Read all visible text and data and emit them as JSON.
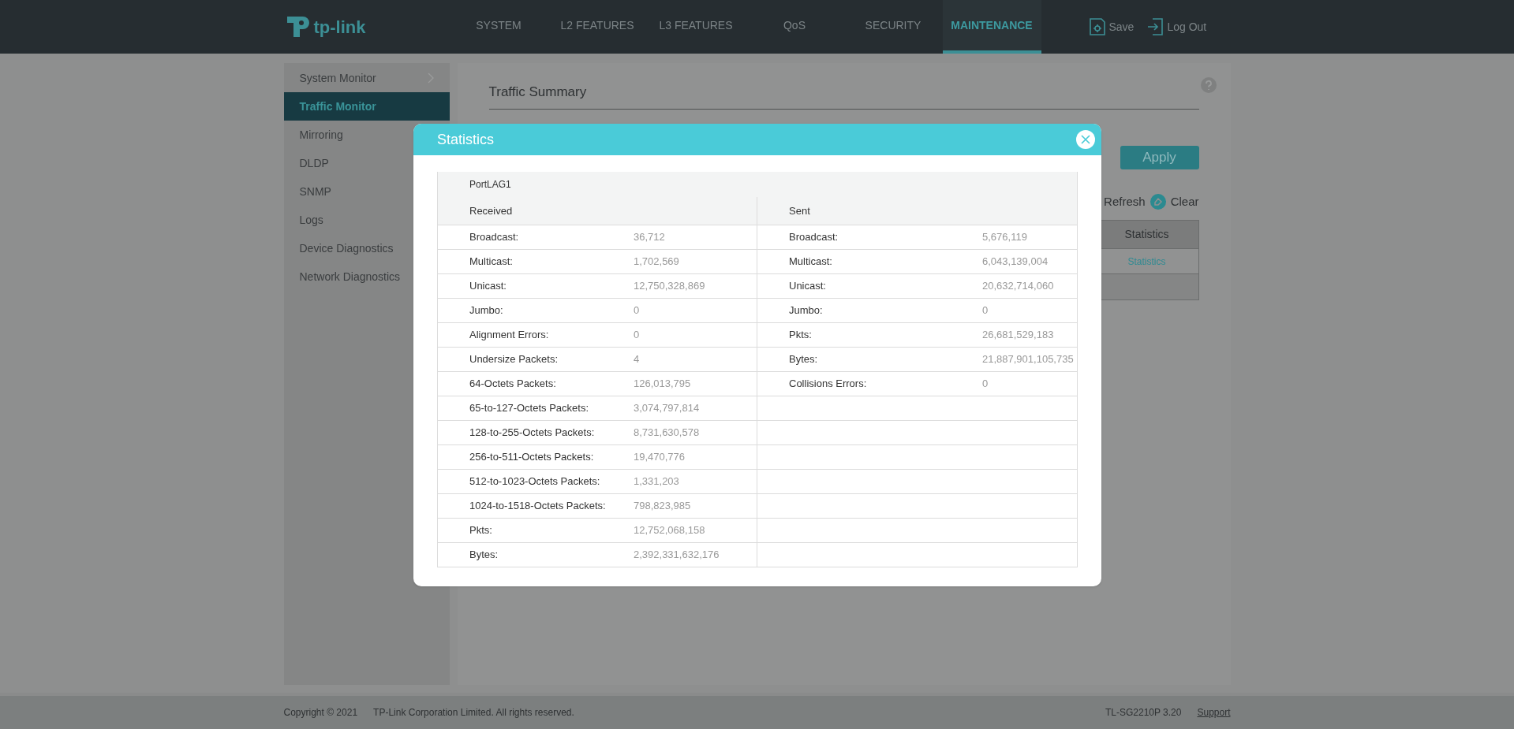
{
  "header": {
    "logo": "tp-link",
    "nav": [
      {
        "label": "SYSTEM",
        "selected": false
      },
      {
        "label": "L2 FEATURES",
        "selected": false
      },
      {
        "label": "L3 FEATURES",
        "selected": false
      },
      {
        "label": "QoS",
        "selected": false
      },
      {
        "label": "SECURITY",
        "selected": false
      },
      {
        "label": "MAINTENANCE",
        "selected": true
      }
    ],
    "actions": [
      {
        "kind": "save",
        "label": "Save"
      },
      {
        "kind": "logout",
        "label": "Log Out"
      }
    ]
  },
  "sidebar": {
    "items": [
      {
        "label": "System Monitor",
        "selected": false,
        "expandable": true
      },
      {
        "label": "Traffic Monitor",
        "selected": true,
        "expandable": false
      },
      {
        "label": "Mirroring",
        "selected": false,
        "expandable": false
      },
      {
        "label": "DLDP",
        "selected": false,
        "expandable": false
      },
      {
        "label": "SNMP",
        "selected": false,
        "expandable": false
      },
      {
        "label": "Logs",
        "selected": false,
        "expandable": false
      },
      {
        "label": "Device Diagnostics",
        "selected": false,
        "expandable": false
      },
      {
        "label": "Network Diagnostics",
        "selected": false,
        "expandable": false
      }
    ]
  },
  "main": {
    "title": "Traffic Summary",
    "apply_button": "Apply",
    "toolbar": [
      {
        "kind": "refresh",
        "label": "Refresh"
      },
      {
        "kind": "clear",
        "label": "Clear"
      }
    ],
    "table": {
      "column_header": "Statistics",
      "rows": [
        {
          "link": "Statistics"
        },
        {}
      ]
    }
  },
  "dialog": {
    "title": "Statistics",
    "port": "PortLAG1",
    "received_header": "Received",
    "sent_header": "Sent",
    "received": [
      {
        "label": "Broadcast:",
        "value": "36,712"
      },
      {
        "label": "Multicast:",
        "value": "1,702,569"
      },
      {
        "label": "Unicast:",
        "value": "12,750,328,869"
      },
      {
        "label": "Jumbo:",
        "value": "0"
      },
      {
        "label": "Alignment Errors:",
        "value": "0"
      },
      {
        "label": "Undersize Packets:",
        "value": "4"
      },
      {
        "label": "64-Octets Packets:",
        "value": "126,013,795"
      },
      {
        "label": "65-to-127-Octets Packets:",
        "value": "3,074,797,814"
      },
      {
        "label": "128-to-255-Octets Packets:",
        "value": "8,731,630,578"
      },
      {
        "label": "256-to-511-Octets Packets:",
        "value": "19,470,776"
      },
      {
        "label": "512-to-1023-Octets Packets:",
        "value": "1,331,203"
      },
      {
        "label": "1024-to-1518-Octets Packets:",
        "value": "798,823,985"
      },
      {
        "label": "Pkts:",
        "value": "12,752,068,158"
      },
      {
        "label": "Bytes:",
        "value": "2,392,331,632,176"
      }
    ],
    "sent": [
      {
        "label": "Broadcast:",
        "value": "5,676,119"
      },
      {
        "label": "Multicast:",
        "value": "6,043,139,004"
      },
      {
        "label": "Unicast:",
        "value": "20,632,714,060"
      },
      {
        "label": "Jumbo:",
        "value": "0"
      },
      {
        "label": "Pkts:",
        "value": "26,681,529,183"
      },
      {
        "label": "Bytes:",
        "value": "21,887,901,105,735"
      },
      {
        "label": "Collisions Errors:",
        "value": "0"
      }
    ]
  },
  "footer": {
    "copyright": "Copyright © 2021",
    "company": "TP-Link Corporation Limited. All rights reserved.",
    "model": "TL-SG2210P 3.20",
    "support_link": "Support"
  }
}
